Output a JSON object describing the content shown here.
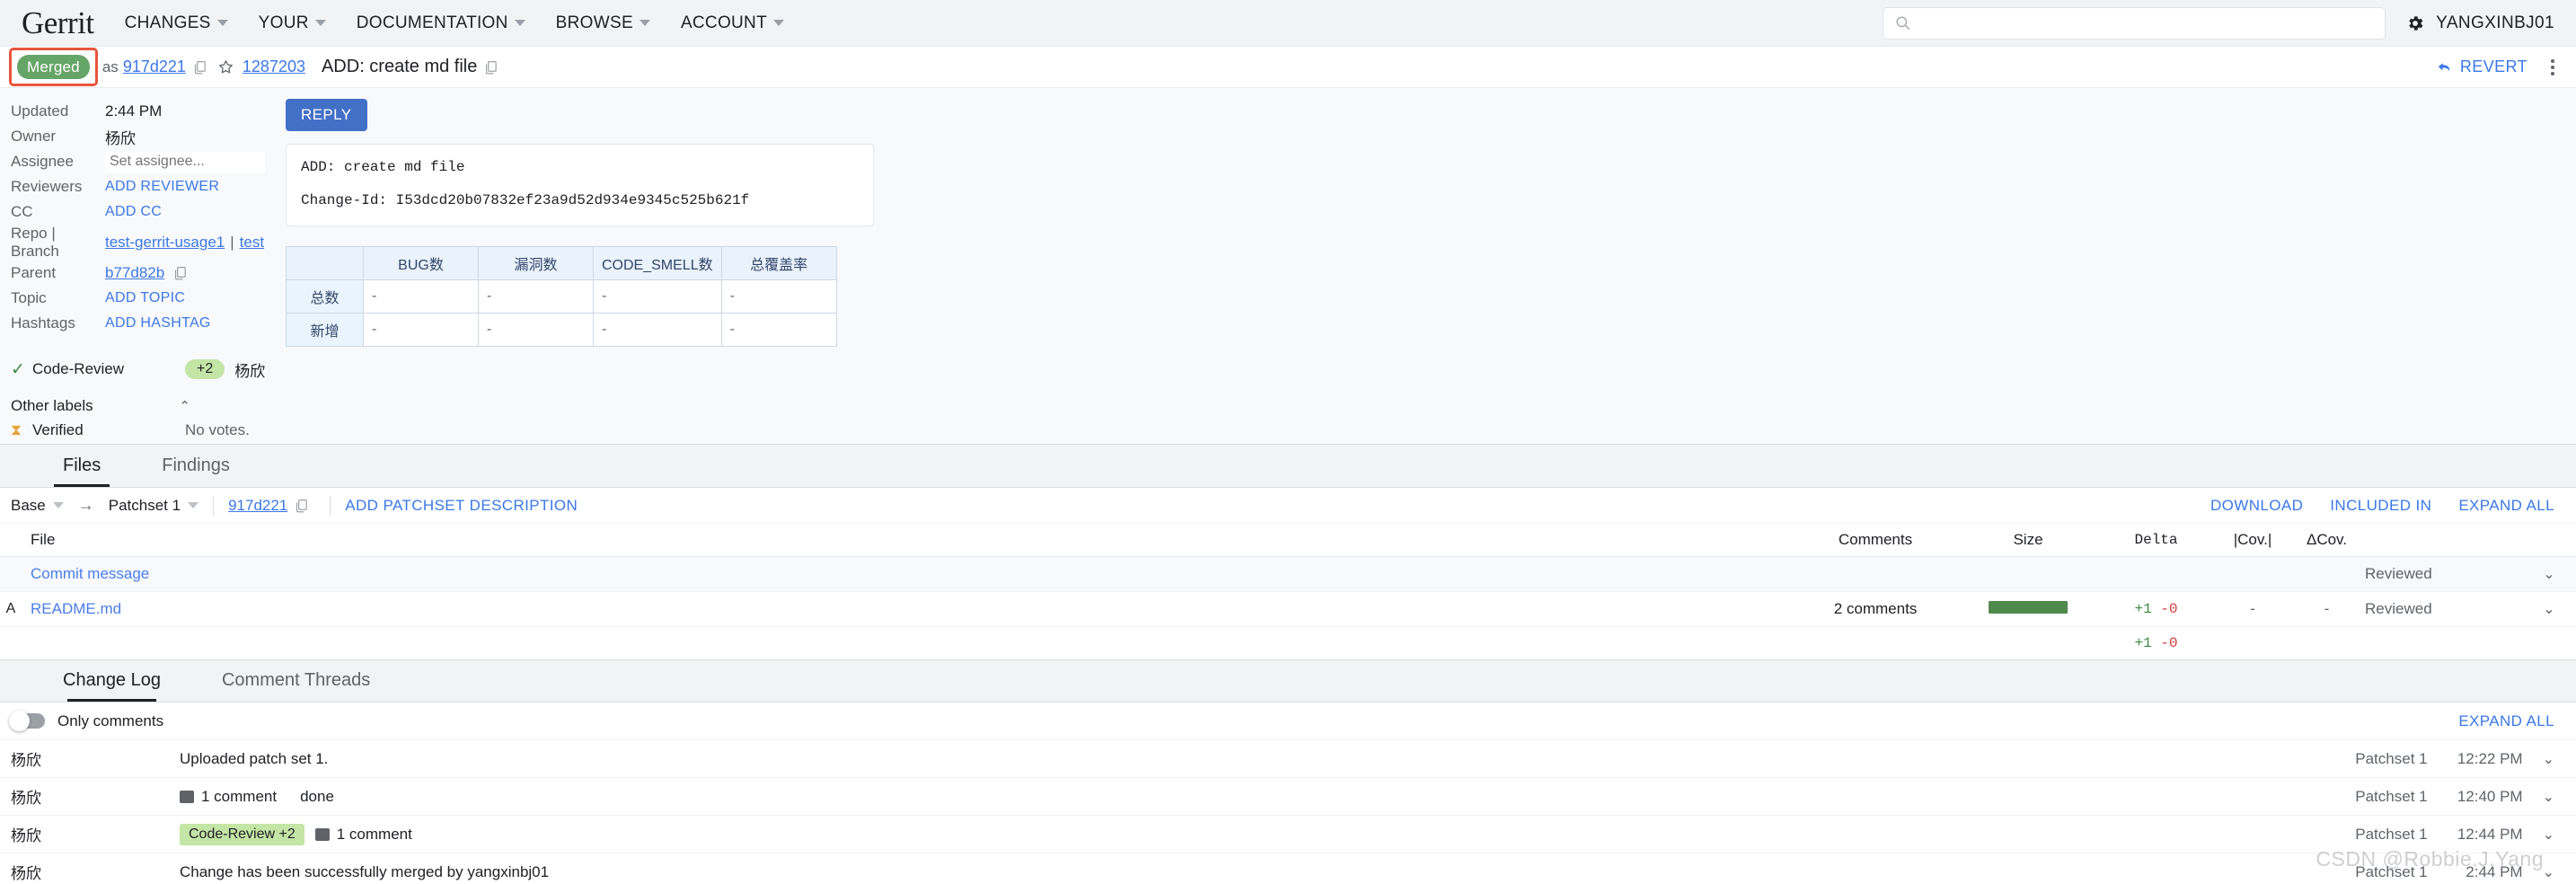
{
  "topnav": {
    "brand": "Gerrit",
    "items": [
      {
        "label": "CHANGES"
      },
      {
        "label": "YOUR"
      },
      {
        "label": "DOCUMENTATION"
      },
      {
        "label": "BROWSE"
      },
      {
        "label": "ACCOUNT"
      }
    ],
    "search": {
      "value": "",
      "placeholder": ""
    },
    "username": "YANGXINBJ01"
  },
  "change_header": {
    "status": "Merged",
    "as_text": "as",
    "commit_sha": "917d221",
    "change_number": "1287203",
    "subject": "ADD: create md file",
    "revert_label": "REVERT"
  },
  "metadata": {
    "rows": [
      {
        "key": "Updated",
        "value": "2:44 PM"
      },
      {
        "key": "Owner",
        "value": "杨欣"
      },
      {
        "key": "Assignee",
        "value": ""
      },
      {
        "key": "Reviewers",
        "value": "ADD REVIEWER"
      },
      {
        "key": "CC",
        "value": "ADD CC"
      },
      {
        "key": "Repo | Branch",
        "value": ""
      },
      {
        "key": "Parent",
        "value": "b77d82b"
      },
      {
        "key": "Topic",
        "value": "ADD TOPIC"
      },
      {
        "key": "Hashtags",
        "value": "ADD HASHTAG"
      }
    ],
    "assignee_placeholder": "Set assignee...",
    "repo": "test-gerrit-usage1",
    "branch": "test",
    "repo_separator": "|"
  },
  "labels": {
    "code_review": {
      "name": "Code-Review",
      "vote": "+2",
      "voter": "杨欣"
    },
    "other_labels_title": "Other labels",
    "verified": {
      "name": "Verified",
      "status": "No votes."
    }
  },
  "message": {
    "reply_label": "REPLY",
    "commit_subject": "ADD: create md file",
    "change_id": "Change-Id: I53dcd20b07832ef23a9d52d934e9345c525b621f"
  },
  "metrics_table": {
    "columns": [
      "BUG数",
      "漏洞数",
      "CODE_SMELL数",
      "总覆盖率"
    ],
    "rows": [
      {
        "label": "总数",
        "values": [
          "-",
          "-",
          "-",
          "-"
        ]
      },
      {
        "label": "新增",
        "values": [
          "-",
          "-",
          "-",
          "-"
        ]
      }
    ]
  },
  "files_section": {
    "tabs": [
      {
        "label": "Files",
        "active": true
      },
      {
        "label": "Findings",
        "active": false
      }
    ],
    "patchset_bar": {
      "base_label": "Base",
      "arrow": "→",
      "patchset_label": "Patchset 1",
      "sha": "917d221",
      "add_description": "ADD PATCHSET DESCRIPTION",
      "actions": [
        "DOWNLOAD",
        "INCLUDED IN",
        "EXPAND ALL"
      ]
    },
    "table": {
      "headers": {
        "file": "File",
        "comments": "Comments",
        "size": "Size",
        "delta": "Delta",
        "cov": "|Cov.|",
        "dcov": "ΔCov."
      },
      "rows": [
        {
          "status": "",
          "file": "Commit message",
          "comments": "",
          "size_bar": false,
          "delta_plus": "",
          "delta_minus": "",
          "cov": "",
          "dcov": "",
          "reviewed": "Reviewed"
        },
        {
          "status": "A",
          "file": "README.md",
          "comments": "2 comments",
          "size_bar": true,
          "delta_plus": "+1",
          "delta_minus": "-0",
          "cov": "-",
          "dcov": "-",
          "reviewed": "Reviewed"
        }
      ],
      "totals": {
        "delta_plus": "+1",
        "delta_minus": "-0"
      }
    }
  },
  "change_log": {
    "tabs": [
      {
        "label": "Change Log",
        "active": true
      },
      {
        "label": "Comment Threads",
        "active": false
      }
    ],
    "only_comments_label": "Only comments",
    "expand_all_label": "EXPAND ALL",
    "entries": [
      {
        "author": "杨欣",
        "text": "Uploaded patch set 1.",
        "comment_count": "",
        "extra": "",
        "vote_pill": "",
        "patchset": "Patchset 1",
        "time": "12:22 PM"
      },
      {
        "author": "杨欣",
        "text": "",
        "comment_count": "1 comment",
        "extra": "done",
        "vote_pill": "",
        "patchset": "Patchset 1",
        "time": "12:40 PM"
      },
      {
        "author": "杨欣",
        "text": "",
        "comment_count": "1 comment",
        "extra": "",
        "vote_pill": "Code-Review +2",
        "patchset": "Patchset 1",
        "time": "12:44 PM"
      },
      {
        "author": "杨欣",
        "text": "Change has been successfully merged by yangxinbj01",
        "comment_count": "",
        "extra": "",
        "vote_pill": "",
        "patchset": "Patchset 1",
        "time": "2:44 PM"
      }
    ]
  },
  "watermark": "CSDN @Robbie.J.Yang"
}
